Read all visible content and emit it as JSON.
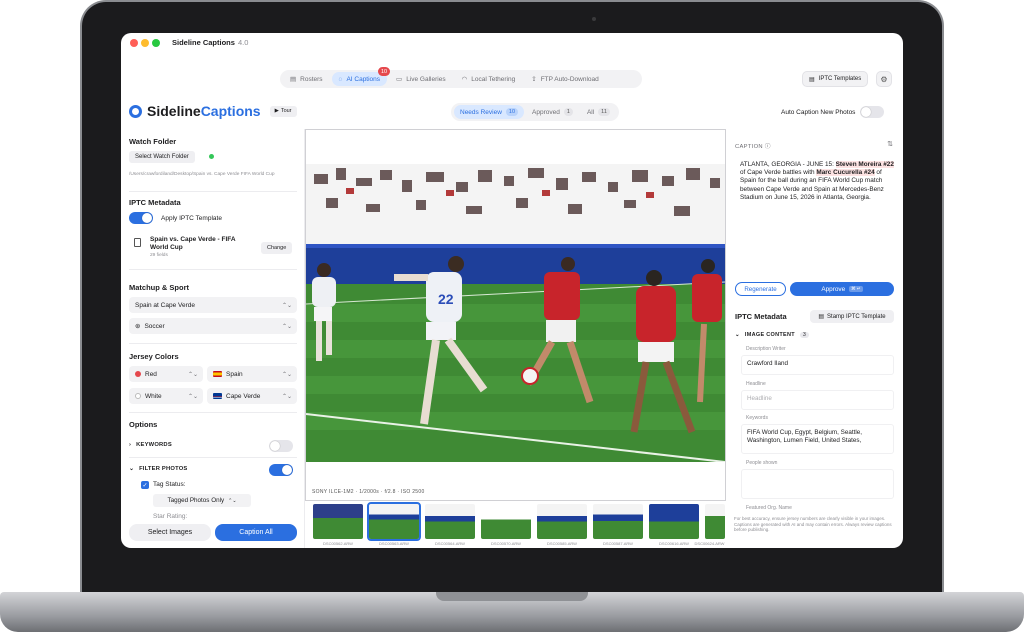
{
  "window": {
    "title": "Sideline Captions",
    "version": "4.0"
  },
  "nav": {
    "tabs": [
      {
        "label": "Rosters",
        "icon": "clipboard-icon"
      },
      {
        "label": "AI Captions",
        "icon": "chat-icon",
        "badge": "10",
        "active": true
      },
      {
        "label": "Live Galleries",
        "icon": "monitor-icon"
      },
      {
        "label": "Local Tethering",
        "icon": "wifi-icon"
      },
      {
        "label": "FTP Auto-Download",
        "icon": "upload-icon"
      }
    ],
    "iptc_templates_label": "IPTC Templates"
  },
  "brand": {
    "name_part1": "Sideline",
    "name_part2": "Captions",
    "tour_label": "Tour"
  },
  "review_tabs": [
    {
      "label": "Needs Review",
      "count": "10",
      "active": true
    },
    {
      "label": "Approved",
      "count": "1"
    },
    {
      "label": "All",
      "count": "11"
    }
  ],
  "auto_caption": {
    "label": "Auto Caption New Photos",
    "on": false
  },
  "left": {
    "watch_folder": {
      "title": "Watch Folder",
      "button": "Select Watch Folder",
      "path": "/Users/crawfordiland/Desktop/Spain vs. Cape Verde FIFA World Cup"
    },
    "iptc": {
      "title": "IPTC Metadata",
      "apply_label": "Apply IPTC Template",
      "template_name": "Spain vs. Cape Verde - FIFA World Cup",
      "template_files": "29 fields",
      "change_label": "Change"
    },
    "matchup": {
      "title": "Matchup & Sport",
      "matchup_value": "Spain at Cape Verde",
      "sport_value": "Soccer"
    },
    "jersey": {
      "title": "Jersey Colors",
      "rows": [
        {
          "color": "Red",
          "swatch": "#e5484d",
          "team": "Spain"
        },
        {
          "color": "White",
          "swatch": "#ffffff",
          "team": "Cape Verde"
        }
      ]
    },
    "options": {
      "title": "Options",
      "keywords_label": "KEYWORDS",
      "filter_label": "FILTER PHOTOS",
      "tag_status_label": "Tag Status:",
      "tag_status_value": "Tagged Photos Only",
      "star_label": "Star Rating:"
    },
    "select_images": "Select Images",
    "caption_all": "Caption All"
  },
  "photo": {
    "exif": "SONY ILCE-1M2 · 1/2000s · f/2.8 · ISO 2500"
  },
  "filmstrip": [
    "DSC00562.ARW",
    "DSC00563.ARW",
    "DSC00564.ARW",
    "DSC00570.ARW",
    "DSC00585.ARW",
    "DSC00587.ARW",
    "DSC00616.ARW",
    "DSC00624.ARW"
  ],
  "right": {
    "caption_title": "CAPTION",
    "caption_parts": {
      "p1": "ATLANTA, GEORGIA - JUNE 15: ",
      "h1": "Steven Moreira #22",
      "p2": " of Cape Verde battles with ",
      "h2": "Marc Cucurella #24",
      "p3": " of Spain for the ball during an FIFA World Cup match between Cape Verde and Spain at Mercedes-Benz Stadium on June 15, 2026 in Atlanta, Georgia."
    },
    "regenerate_label": "Regenerate",
    "approve_label": "Approve",
    "approve_kbd": "⌘ ↵",
    "iptc_title": "IPTC Metadata",
    "stamp_label": "Stamp IPTC Template",
    "image_content_label": "IMAGE CONTENT",
    "image_content_count": "3",
    "fields": {
      "description_writer_label": "Description Writer",
      "description_writer_value": "Crawford Iland",
      "headline_label": "Headline",
      "headline_placeholder": "Headline",
      "keywords_label": "Keywords",
      "keywords_value": "FIFA World Cup, Egypt, Belgium, Seattle, Washington, Lumen Field, United States,",
      "people_shown_label": "People shown",
      "featured_org_label": "Featured Org. Name"
    },
    "footer_note": "For best accuracy, ensure jersey numbers are clearly visible in your images. Captions are generated with AI and may contain errors. Always review captions before publishing."
  },
  "colors": {
    "accent": "#2b6fe0",
    "badge": "#e5484d",
    "pitch": "#3f8a34"
  }
}
